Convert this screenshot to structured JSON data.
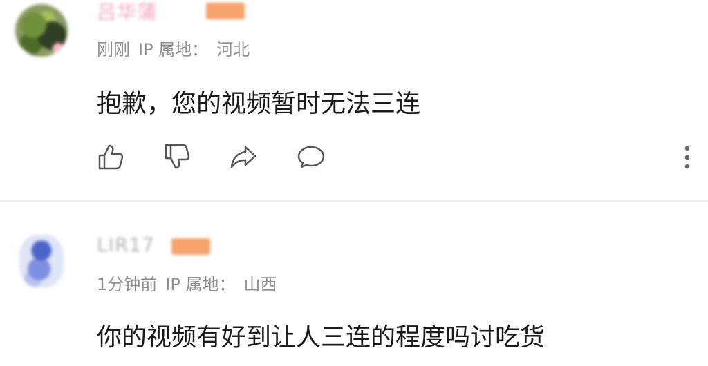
{
  "comments": [
    {
      "username": "吕华蒲 ",
      "time": "刚刚",
      "ip_label": "IP 属地：",
      "ip_location": "河北",
      "content": "抱歉，您的视频暂时无法三连"
    },
    {
      "username": "LIR17",
      "time": "1分钟前",
      "ip_label": "IP 属地：",
      "ip_location": "山西",
      "content": "你的视频有好到让人三连的程度吗讨吃货"
    }
  ],
  "actions": {
    "like_icon": "thumbs-up-icon",
    "dislike_icon": "thumbs-down-icon",
    "share_icon": "share-icon",
    "reply_icon": "comment-icon",
    "more_icon": "more-vertical-icon"
  },
  "colors": {
    "icon": "#555555",
    "meta_text": "#8f8f8f",
    "body_text": "#1b1b1b",
    "level_badge": "#f6a36d",
    "username_pink": "#f3a6c1",
    "divider": "#eeeeee"
  }
}
